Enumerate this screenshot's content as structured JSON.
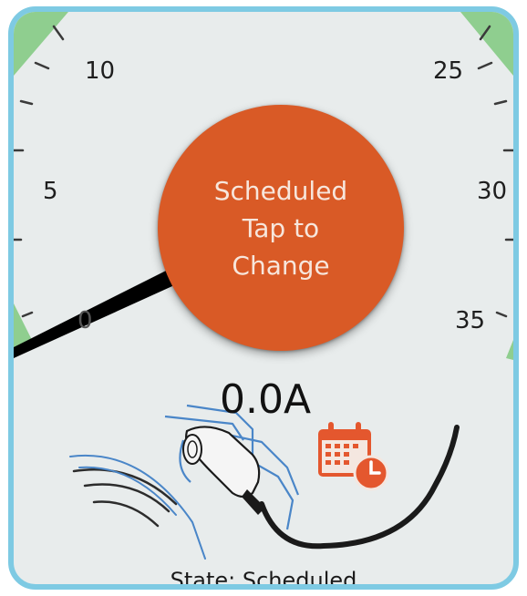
{
  "gauge": {
    "tick_labels": {
      "t0": "0",
      "t5": "5",
      "t10": "10",
      "t25": "25",
      "t30": "30",
      "t35": "35"
    },
    "needle_value": 0,
    "range": [
      0,
      40
    ],
    "safe_zone_color": "#8fce8f"
  },
  "schedule_button": {
    "line1": "Scheduled",
    "line2": "Tap to",
    "line3": "Change",
    "color": "#d95a26"
  },
  "readout": {
    "current": "0.0A"
  },
  "status": {
    "state_text": "State: Scheduled"
  },
  "icons": {
    "calendar": "calendar-clock-icon",
    "charger": "ev-charger-plug-icon"
  },
  "colors": {
    "frame_border": "#7ecae3",
    "background": "#e8ecec",
    "accent": "#d95a26",
    "car_outline": "#4a86c8"
  }
}
